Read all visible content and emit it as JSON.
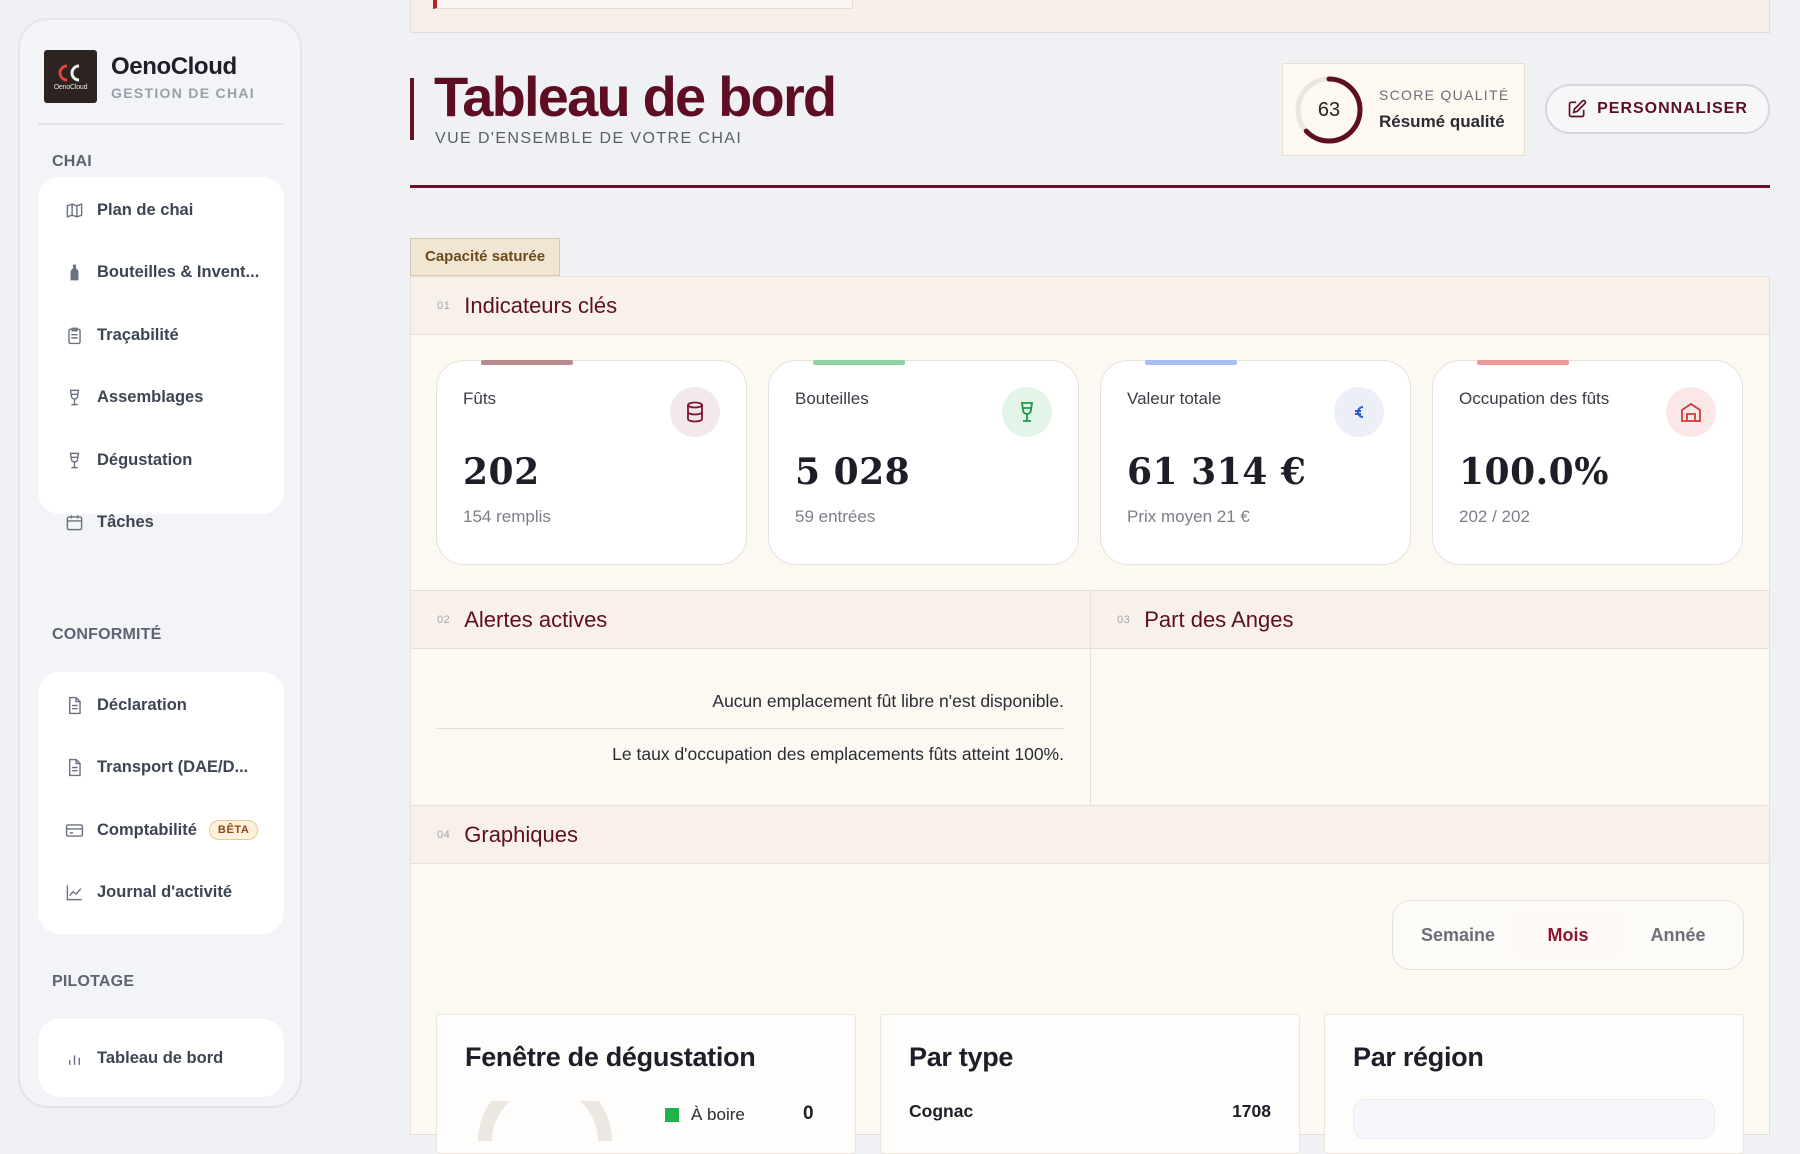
{
  "brand": {
    "logo_text": "OenoCloud",
    "name": "OenoCloud",
    "subtitle": "GESTION DE CHAI"
  },
  "sidebar": {
    "sections": [
      {
        "title": "CHAI",
        "items": [
          {
            "label": "Plan de chai",
            "icon": "map-icon"
          },
          {
            "label": "Bouteilles & Invent...",
            "icon": "bottle-icon"
          },
          {
            "label": "Traçabilité",
            "icon": "clipboard-icon"
          },
          {
            "label": "Assemblages",
            "icon": "glass-icon"
          },
          {
            "label": "Dégustation",
            "icon": "glass-icon"
          },
          {
            "label": "Tâches",
            "icon": "calendar-icon"
          }
        ]
      },
      {
        "title": "CONFORMITÉ",
        "items": [
          {
            "label": "Déclaration",
            "icon": "document-icon"
          },
          {
            "label": "Transport (DAE/D...",
            "icon": "document-icon"
          },
          {
            "label": "Comptabilité",
            "icon": "credit-card-icon",
            "badge": "BÊTA"
          },
          {
            "label": "Journal d'activité",
            "icon": "line-chart-icon"
          }
        ]
      },
      {
        "title": "PILOTAGE",
        "items": [
          {
            "label": "Tableau de bord",
            "icon": "bar-chart-icon"
          }
        ]
      }
    ]
  },
  "header": {
    "title": "Tableau de bord",
    "subtitle": "VUE D'ENSEMBLE DE VOTRE CHAI",
    "score": {
      "value": "63",
      "label": "SCORE QUALITÉ",
      "sublabel": "Résumé qualité",
      "percent": 63
    },
    "customize_label": "PERSONNALISER"
  },
  "status_tag": "Capacité saturée",
  "sections": {
    "kpis": {
      "num": "01",
      "title": "Indicateurs clés"
    },
    "alerts": {
      "num": "02",
      "title": "Alertes actives"
    },
    "angels": {
      "num": "03",
      "title": "Part des Anges"
    },
    "charts": {
      "num": "04",
      "title": "Graphiques"
    }
  },
  "kpis": [
    {
      "label": "Fûts",
      "value": "202",
      "sub": "154 remplis",
      "icon": "barrel-icon",
      "accent": "#b98a8e",
      "icon_bg": "#f3e9ea",
      "icon_color": "#7a1630"
    },
    {
      "label": "Bouteilles",
      "value": "5 028",
      "sub": "59 entrées",
      "icon": "wine-glass-icon",
      "accent": "#8fd3a3",
      "icon_bg": "#e2f5e8",
      "icon_color": "#1f9a4a"
    },
    {
      "label": "Valeur totale",
      "value": "61 314 €",
      "sub": "Prix moyen 21 €",
      "icon": "euro-icon",
      "accent": "#a9bff2",
      "icon_bg": "#eceff8",
      "icon_color": "#2f5bd0"
    },
    {
      "label": "Occupation des fûts",
      "value": "100.0%",
      "sub": "202 / 202",
      "icon": "warehouse-icon",
      "accent": "#ef9a9a",
      "icon_bg": "#fbe7e7",
      "icon_color": "#d23a3a"
    }
  ],
  "alerts": [
    "Aucun emplacement fût libre n'est disponible.",
    "Le taux d'occupation des emplacements fûts atteint 100%."
  ],
  "period_toggle": {
    "options": [
      "Semaine",
      "Mois",
      "Année"
    ],
    "selected": "Mois"
  },
  "chart_cards": [
    {
      "title": "Fenêtre de dégustation",
      "legend_label": "À boire",
      "legend_value": "0",
      "legend_color": "#22b04b"
    },
    {
      "title": "Par type",
      "first_row_label": "Cognac",
      "first_row_value": "1708"
    },
    {
      "title": "Par région"
    }
  ],
  "colors": {
    "brand": "#5e0e22",
    "accent_red": "#b5232d",
    "active_tab": "#8c1431"
  }
}
